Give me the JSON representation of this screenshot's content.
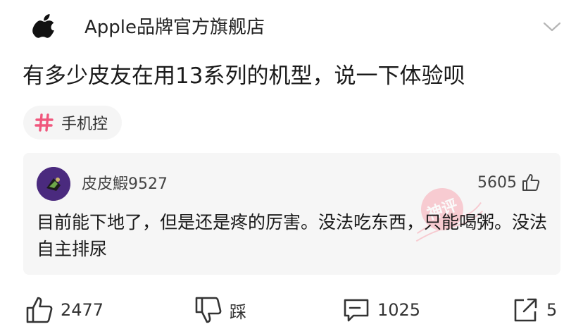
{
  "header": {
    "logo_icon": "apple-logo-icon",
    "brand_name": "Apple品牌官方旗舰店",
    "expand_icon": "chevron-down-icon"
  },
  "post": {
    "title": "有多少皮友在用13系列的机型，说一下体验呗",
    "tag": {
      "icon": "hashtag-icon",
      "label": "手机控",
      "icon_color": "#f0577d"
    }
  },
  "comment": {
    "author": "皮皮鰕9527",
    "likes": "5605",
    "text": "目前能下地了，但是还是疼的厉害。没法吃东西，只能喝粥。没法自主排尿",
    "stamp_text": "神评"
  },
  "actions": {
    "like": {
      "icon": "thumbs-up-icon",
      "label": "2477"
    },
    "dislike": {
      "icon": "thumbs-down-icon",
      "label": "踩"
    },
    "comments": {
      "icon": "comment-icon",
      "label": "1025"
    },
    "share": {
      "icon": "share-icon",
      "label": "5"
    }
  },
  "colors": {
    "accent_pink": "#f0577d",
    "stamp_red": "#f26b7a",
    "comment_bg": "#f6f6f6"
  }
}
